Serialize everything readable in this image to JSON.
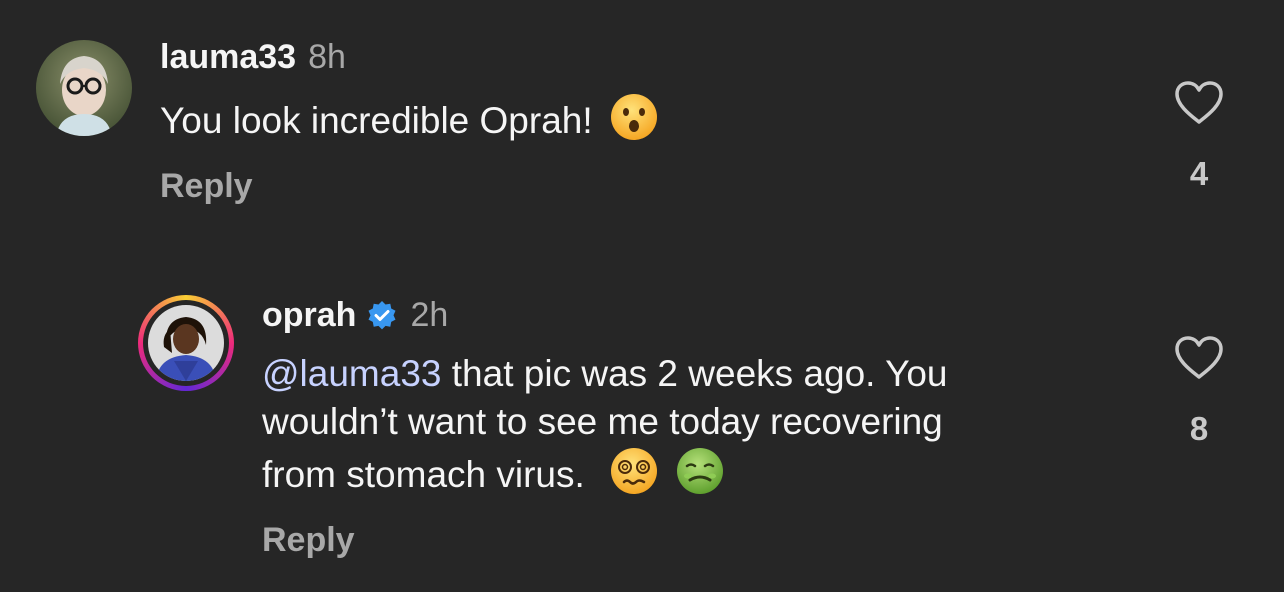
{
  "comments": [
    {
      "username": "lauma33",
      "time": "8h",
      "text": "You look incredible Oprah!",
      "emoji": "astonished-face",
      "reply_label": "Reply",
      "likes": "4"
    },
    {
      "username": "oprah",
      "verified": true,
      "time": "2h",
      "mention": "@lauma33",
      "text_line1": " that pic was 2 weeks ago. You",
      "text_line2": "wouldn’t want to see me today recovering",
      "text_line3": "from stomach virus.",
      "emojis": [
        "dizzy-face",
        "nauseated-face"
      ],
      "reply_label": "Reply",
      "likes": "8"
    }
  ],
  "colors": {
    "background": "#262626",
    "primary_text": "#f5f5f5",
    "secondary_text": "#a8a8a8",
    "mention": "#c7d2ff",
    "verified_badge": "#3897f0"
  }
}
